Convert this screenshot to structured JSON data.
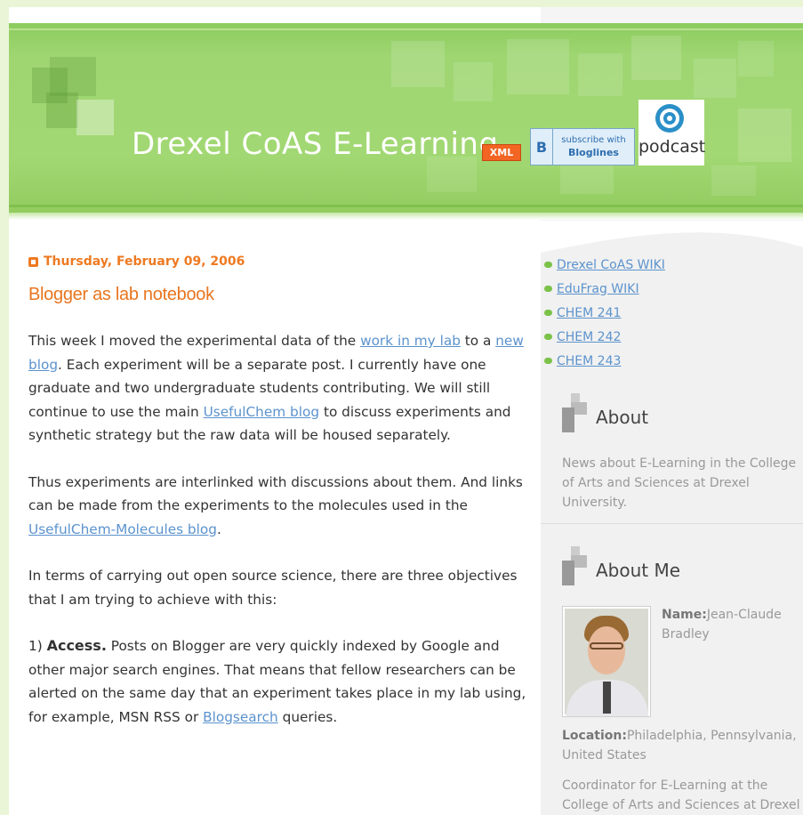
{
  "header": {
    "title": "Drexel CoAS E-Learning",
    "xml_badge": "XML",
    "bloglines": {
      "letter": "B",
      "line1": "subscribe with",
      "line2": "Bloglines"
    },
    "podcast_label": "podcast"
  },
  "post": {
    "date": "Thursday, February 09, 2006",
    "title": "Blogger as lab notebook",
    "p1": {
      "t1": "This week I moved the experimental data of the ",
      "link1": "work in my lab",
      "t2": " to a ",
      "link2": "new blog",
      "t3": ". Each experiment will be a separate post. I currently have one graduate and two undergraduate students contributing. We will still continue to use the main ",
      "link3": "UsefulChem blog",
      "t4": " to discuss experiments and synthetic strategy but the raw data will be housed separately."
    },
    "p2": {
      "t1": "Thus experiments are interlinked with discussions about them. And links can be made from the experiments to the molecules used in the ",
      "link1": "UsefulChem-Molecules blog",
      "t2": "."
    },
    "p3": "In terms of carrying out open source science, there are three objectives that I am trying to achieve with this:",
    "p4": {
      "num": "1) ",
      "strong": "Access.",
      "t1": " Posts on Blogger are very quickly indexed by Google and other major search engines. That means that fellow researchers can be alerted on the same day that an experiment takes place in my lab using, for example, MSN RSS or ",
      "link1": "Blogsearch",
      "t2": " queries."
    }
  },
  "sidebar": {
    "links": [
      "Drexel CoAS WIKI",
      "EduFrag WIKI",
      "CHEM 241",
      "CHEM 242",
      "CHEM 243"
    ],
    "about_heading": "About",
    "about_text": "News about E-Learning in the College of Arts and Sciences at Drexel University.",
    "aboutme_heading": "About Me",
    "profile": {
      "name_label": "Name:",
      "name": "Jean-Claude Bradley",
      "location_label": "Location:",
      "location": "Philadelphia, Pennsylvania, United States",
      "description": "Coordinator for E-Learning at the College of Arts and Sciences at Drexel"
    }
  },
  "colors": {
    "header_green": "#a2d873",
    "accent_orange": "#e8751f",
    "link_blue": "#5c93cd",
    "bullet_green": "#7cc24a"
  }
}
